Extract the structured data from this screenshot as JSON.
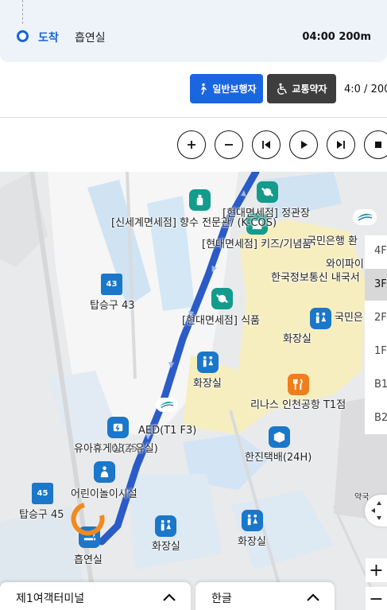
{
  "arrival": {
    "label": "도착",
    "place": "흡연실",
    "meta": "04:00 200m"
  },
  "modes": {
    "walk_label": "일반보행자",
    "mobility_label": "교통약자",
    "speed": "4:0 / 200"
  },
  "controls": [
    "zoom-in",
    "zoom-out",
    "previous",
    "play",
    "next",
    "stop"
  ],
  "map": {
    "labels": {
      "shinsegae": "[신세계면세점] 향수 전문관/ (K-COS)",
      "hyundai_jewel": "[현대면세점] 정관장",
      "hyundai_kids": "[현대면세점] 키즈/기념품",
      "kb_bank": "국민은행 환",
      "wifi": "와이파이",
      "kt": "한국정보통신 내국서",
      "gate43": "탑승구 43",
      "gate43_num": "43",
      "hyundai_food": "[현대면세점] 식품",
      "restroom1": "화장실",
      "kb_short": "국민은",
      "restroom2": "화장실",
      "aed": "AED(T1 F3)",
      "renas": "리나스 인천공항 T1점",
      "nursing": "유아휴게실(수유실)",
      "nursing_overlap": "0325",
      "hanjin": "한진택배(24H)",
      "kids_play": "어린이놀이시설",
      "gate45": "탑승구 45",
      "gate45_num": "45",
      "pharmacy": "약국",
      "smoking": "흡연실",
      "restroom3": "화장실",
      "restroom4": "화장실"
    },
    "floors": [
      "4F",
      "3F",
      "2F",
      "1F",
      "B1",
      "B2"
    ],
    "active_floor": "3F",
    "route_color": "#2a5bc7",
    "destination_marker_color": "#f08a1e"
  },
  "bottom": {
    "terminal": "제1여객터미널",
    "language": "한글"
  },
  "colors": {
    "primary": "#1a66e0",
    "dark_button": "#3e3e3e",
    "poi_teal": "#149b8c",
    "poi_blue": "#1a77c9",
    "poi_orange": "#ef7e1c",
    "zone_yellow": "#f8efbf",
    "corridor_blue": "#cfe3f3"
  }
}
